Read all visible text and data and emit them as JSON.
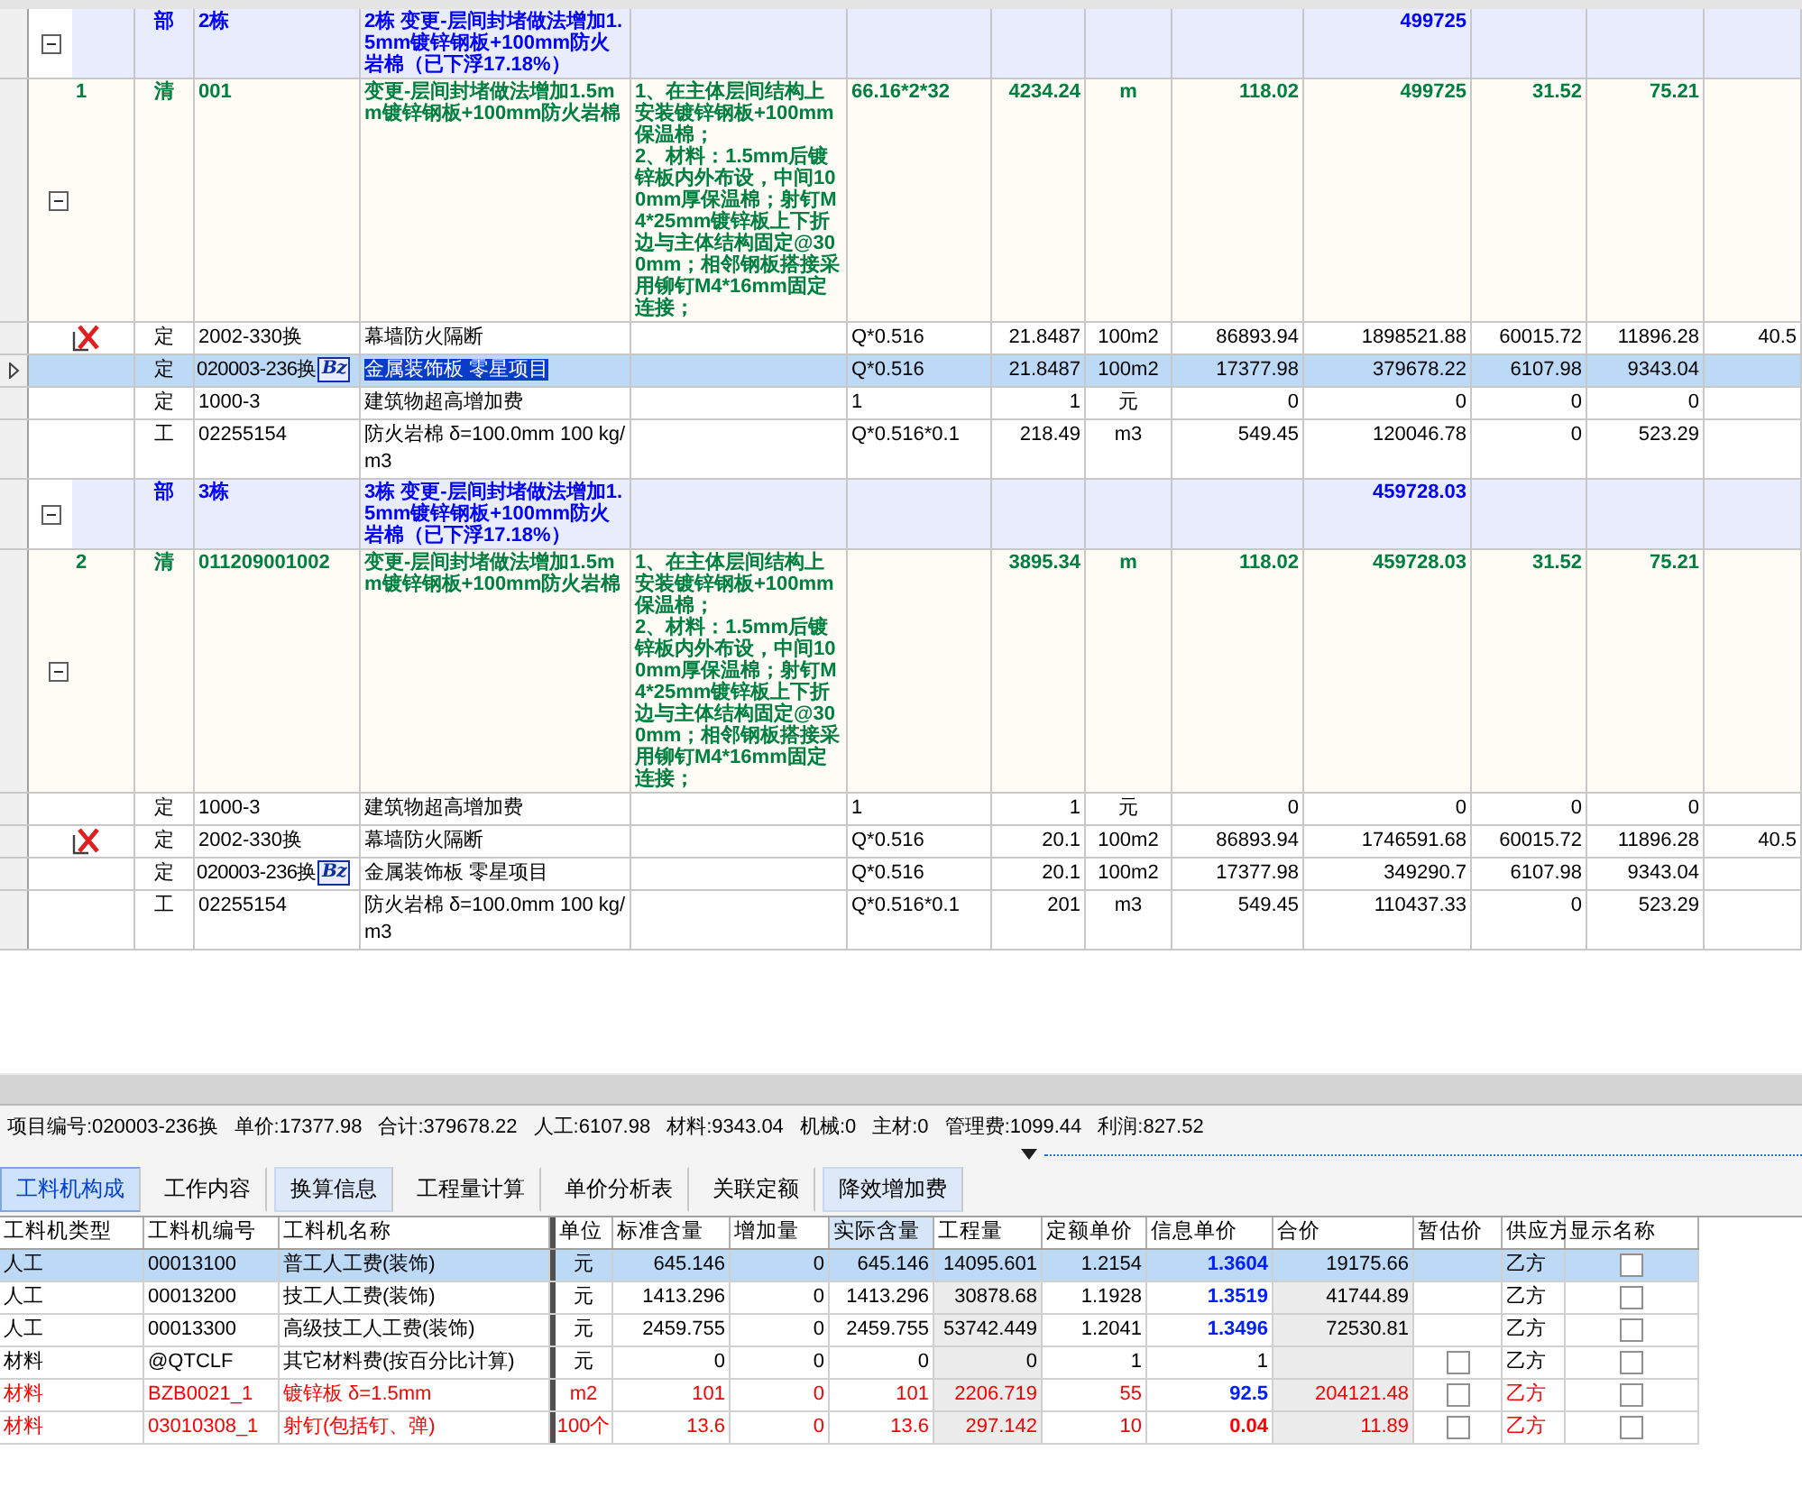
{
  "grid": {
    "rows": [
      {
        "kind": "section",
        "expanded": true,
        "selected": false,
        "type": "部",
        "code": "2栋",
        "name": "2栋 变更-层间封堵做法增加1.5mm镀锌钢板+100mm防火岩棉（已下浮17.18%）",
        "total": "499725"
      },
      {
        "kind": "item",
        "expanded": true,
        "selected": false,
        "seq": "1",
        "type": "清",
        "code": "001",
        "name": "变更-层间封堵做法增加1.5mm镀锌钢板+100mm防火岩棉",
        "feature": "1、在主体层间结构上安装镀锌钢板+100mm保温棉；\n2、材料：1.5mm后镀锌板内外布设，中间100mm厚保温棉；射钉M4*25mm镀锌板上下折边与主体结构固定@300mm；相邻钢板搭接采用铆钉M4*16mm固定连接；",
        "expression": "66.16*2*32",
        "quantity": "4234.24",
        "unit": "m",
        "price": "118.02",
        "total": "499725",
        "column_12": "31.52",
        "column_13": "75.21"
      },
      {
        "kind": "norm",
        "selected": false,
        "marked": true,
        "type": "定",
        "code": "2002-330换",
        "name": "幕墙防火隔断",
        "expression": "Q*0.516",
        "quantity": "21.8487",
        "unit": "100m2",
        "price": "86893.94",
        "total": "1898521.88",
        "column_12": "60015.72",
        "column_13": "11896.28",
        "column_14": "40.5"
      },
      {
        "kind": "norm",
        "selected": true,
        "marked": false,
        "type": "定",
        "code": "020003-236换",
        "tag": "Bz",
        "name": "金属装饰板 零星项目",
        "expression": "Q*0.516",
        "quantity": "21.8487",
        "unit": "100m2",
        "price": "17377.98",
        "total": "379678.22",
        "column_12": "6107.98",
        "column_13": "9343.04"
      },
      {
        "kind": "norm",
        "selected": false,
        "marked": false,
        "type": "定",
        "code": "1000-3",
        "name": "建筑物超高增加费",
        "expression": "1",
        "quantity": "1",
        "unit": "元",
        "price": "0",
        "total": "0",
        "column_12": "0",
        "column_13": "0"
      },
      {
        "kind": "norm",
        "selected": false,
        "marked": false,
        "type": "工",
        "code": "02255154",
        "name": "防火岩棉 δ=100.0mm 100 kg/m3",
        "expression": "Q*0.516*0.1",
        "quantity": "218.49",
        "unit": "m3",
        "price": "549.45",
        "total": "120046.78",
        "column_12": "0",
        "column_13": "523.29"
      },
      {
        "kind": "section",
        "expanded": true,
        "selected": false,
        "type": "部",
        "code": "3栋",
        "name": "3栋 变更-层间封堵做法增加1.5mm镀锌钢板+100mm防火岩棉（已下浮17.18%）",
        "total": "459728.03"
      },
      {
        "kind": "item",
        "expanded": true,
        "selected": false,
        "seq": "2",
        "type": "清",
        "code": "011209001002",
        "name": "变更-层间封堵做法增加1.5mm镀锌钢板+100mm防火岩棉",
        "feature": "1、在主体层间结构上安装镀锌钢板+100mm保温棉；\n2、材料：1.5mm后镀锌板内外布设，中间100mm厚保温棉；射钉M4*25mm镀锌板上下折边与主体结构固定@300mm；相邻钢板搭接采用铆钉M4*16mm固定连接；",
        "quantity": "3895.34",
        "unit": "m",
        "price": "118.02",
        "total": "459728.03",
        "column_12": "31.52",
        "column_13": "75.21"
      },
      {
        "kind": "norm",
        "selected": false,
        "marked": false,
        "type": "定",
        "code": "1000-3",
        "name": "建筑物超高增加费",
        "expression": "1",
        "quantity": "1",
        "unit": "元",
        "price": "0",
        "total": "0",
        "column_12": "0",
        "column_13": "0"
      },
      {
        "kind": "norm",
        "selected": false,
        "marked": true,
        "type": "定",
        "code": "2002-330换",
        "name": "幕墙防火隔断",
        "expression": "Q*0.516",
        "quantity": "20.1",
        "unit": "100m2",
        "price": "86893.94",
        "total": "1746591.68",
        "column_12": "60015.72",
        "column_13": "11896.28",
        "column_14": "40.5"
      },
      {
        "kind": "norm",
        "selected": false,
        "marked": false,
        "type": "定",
        "code": "020003-236换",
        "tag": "Bz",
        "name": "金属装饰板 零星项目",
        "expression": "Q*0.516",
        "quantity": "20.1",
        "unit": "100m2",
        "price": "17377.98",
        "total": "349290.7",
        "column_12": "6107.98",
        "column_13": "9343.04"
      },
      {
        "kind": "norm",
        "selected": false,
        "marked": false,
        "type": "工",
        "code": "02255154",
        "name": "防火岩棉 δ=100.0mm 100 kg/m3",
        "expression": "Q*0.516*0.1",
        "quantity": "201",
        "unit": "m3",
        "price": "549.45",
        "total": "110437.33",
        "column_12": "0",
        "column_13": "523.29"
      }
    ]
  },
  "info_bar": [
    "项目编号:020003-236换",
    "单价:17377.98",
    "合计:379678.22",
    "人工:6107.98",
    "材料:9343.04",
    "机械:0",
    "主材:0",
    "管理费:1099.44",
    "利润:827.52"
  ],
  "tabs": [
    {
      "label": "工料机构成",
      "selected": true,
      "shaded": false
    },
    {
      "label": "工作内容",
      "selected": false,
      "shaded": false
    },
    {
      "label": "换算信息",
      "selected": false,
      "shaded": true
    },
    {
      "label": "工程量计算",
      "selected": false,
      "shaded": false
    },
    {
      "label": "单价分析表",
      "selected": false,
      "shaded": false
    },
    {
      "label": "关联定额",
      "selected": false,
      "shaded": false
    },
    {
      "label": "降效增加费",
      "selected": false,
      "shaded": true
    }
  ],
  "resource_table": {
    "columns": [
      {
        "label": "工料机类型",
        "selected": false
      },
      {
        "label": "工料机编号",
        "selected": false
      },
      {
        "label": "工料机名称",
        "selected": false
      },
      {
        "label": "单位",
        "selected": false
      },
      {
        "label": "标准含量",
        "selected": false
      },
      {
        "label": "增加量",
        "selected": false
      },
      {
        "label": "实际含量",
        "selected": true
      },
      {
        "label": "工程量",
        "selected": false
      },
      {
        "label": "定额单价",
        "selected": false
      },
      {
        "label": "信息单价",
        "selected": false
      },
      {
        "label": "合价",
        "selected": false
      },
      {
        "label": "暂估价",
        "selected": false
      },
      {
        "label": "供应方",
        "selected": false
      },
      {
        "label": "显示名称",
        "selected": false
      }
    ],
    "rows": [
      {
        "selected": true,
        "color": "#000000",
        "type": "人工",
        "code": "00013100",
        "name": "普工人工费(装饰)",
        "unit": "元",
        "standard": "645.146",
        "added": "0",
        "actual": "645.146",
        "quantity": "14095.601",
        "norm_price": "1.2154",
        "info_price": "1.3604",
        "info_highlighted": true,
        "info_above_norm": true,
        "total": "19175.66",
        "supplier": "乙方",
        "show_name_checked": false
      },
      {
        "selected": false,
        "color": "#000000",
        "type": "人工",
        "code": "00013200",
        "name": "技工人工费(装饰)",
        "unit": "元",
        "standard": "1413.296",
        "added": "0",
        "actual": "1413.296",
        "quantity": "30878.68",
        "norm_price": "1.1928",
        "info_price": "1.3519",
        "info_highlighted": true,
        "info_above_norm": true,
        "total": "41744.89",
        "supplier": "乙方",
        "show_name_checked": false
      },
      {
        "selected": false,
        "color": "#000000",
        "type": "人工",
        "code": "00013300",
        "name": "高级技工人工费(装饰)",
        "unit": "元",
        "standard": "2459.755",
        "added": "0",
        "actual": "2459.755",
        "quantity": "53742.449",
        "norm_price": "1.2041",
        "info_price": "1.3496",
        "info_highlighted": true,
        "info_above_norm": true,
        "total": "72530.81",
        "supplier": "乙方",
        "show_name_checked": false
      },
      {
        "selected": false,
        "color": "#000000",
        "type": "材料",
        "code": "@QTCLF",
        "name": "其它材料费(按百分比计算)",
        "unit": "元",
        "standard": "0",
        "added": "0",
        "actual": "0",
        "quantity": "0",
        "norm_price": "1",
        "info_price": "1",
        "provisional_checked": false,
        "supplier": "乙方",
        "show_name_checked": false
      },
      {
        "selected": false,
        "color": "#ff0000",
        "type": "材料",
        "code": "BZB0021_1",
        "name": "镀锌板 δ=1.5mm",
        "unit": "m2",
        "standard": "101",
        "added": "0",
        "actual": "101",
        "quantity": "2206.719",
        "norm_price": "55",
        "info_price": "92.5",
        "info_highlighted": true,
        "info_above_norm": true,
        "total": "204121.48",
        "provisional_checked": false,
        "supplier": "乙方",
        "show_name_checked": false
      },
      {
        "selected": false,
        "color": "#ff0000",
        "type": "材料",
        "code": "03010308_1",
        "name": "射钉(包括钉、弹)",
        "unit": "100个",
        "standard": "13.6",
        "added": "0",
        "actual": "13.6",
        "quantity": "297.142",
        "norm_price": "10",
        "info_price": "0.04",
        "info_highlighted": true,
        "info_above_norm": false,
        "total": "11.89",
        "provisional_checked": false,
        "supplier": "乙方",
        "show_name_checked": false
      }
    ]
  }
}
